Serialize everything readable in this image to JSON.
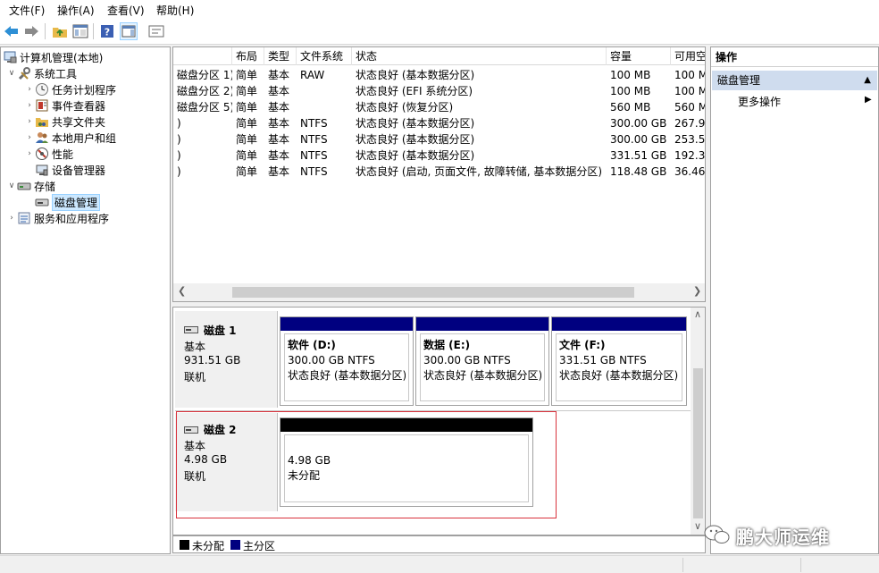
{
  "menu": [
    "文件(F)",
    "操作(A)",
    "查看(V)",
    "帮助(H)"
  ],
  "tree": {
    "root": "计算机管理(本地)",
    "system_tools": "系统工具",
    "task_scheduler": "任务计划程序",
    "event_viewer": "事件查看器",
    "shared_folders": "共享文件夹",
    "local_users": "本地用户和组",
    "performance": "性能",
    "device_manager": "设备管理器",
    "storage": "存储",
    "disk_management": "磁盘管理",
    "services_apps": "服务和应用程序"
  },
  "volume_list": {
    "columns": [
      "",
      "布局",
      "类型",
      "文件系统",
      "状态",
      "容量",
      "可用空"
    ],
    "rows": [
      [
        "磁盘分区 1)",
        "简单",
        "基本",
        "RAW",
        "状态良好 (基本数据分区)",
        "100 MB",
        "100 M"
      ],
      [
        "磁盘分区 2)",
        "简单",
        "基本",
        "",
        "状态良好 (EFI 系统分区)",
        "100 MB",
        "100 M"
      ],
      [
        "磁盘分区 5)",
        "简单",
        "基本",
        "",
        "状态良好 (恢复分区)",
        "560 MB",
        "560 M"
      ],
      [
        ")",
        "简单",
        "基本",
        "NTFS",
        "状态良好 (基本数据分区)",
        "300.00 GB",
        "267.9"
      ],
      [
        ")",
        "简单",
        "基本",
        "NTFS",
        "状态良好 (基本数据分区)",
        "300.00 GB",
        "253.5"
      ],
      [
        ")",
        "简单",
        "基本",
        "NTFS",
        "状态良好 (基本数据分区)",
        "331.51 GB",
        "192.3"
      ],
      [
        ")",
        "简单",
        "基本",
        "NTFS",
        "状态良好 (启动, 页面文件, 故障转储, 基本数据分区)",
        "118.48 GB",
        "36.46"
      ]
    ]
  },
  "disks": {
    "disk1": {
      "name": "磁盘 1",
      "type": "基本",
      "size": "931.51 GB",
      "status": "联机",
      "partitions": [
        {
          "label": "软件 (D:)",
          "size": "300.00 GB NTFS",
          "status": "状态良好 (基本数据分区)"
        },
        {
          "label": "数据 (E:)",
          "size": "300.00 GB NTFS",
          "status": "状态良好 (基本数据分区)"
        },
        {
          "label": "文件 (F:)",
          "size": "331.51 GB NTFS",
          "status": "状态良好 (基本数据分区)"
        }
      ]
    },
    "disk2": {
      "name": "磁盘 2",
      "type": "基本",
      "size": "4.98 GB",
      "status": "联机",
      "partitions": [
        {
          "size": "4.98 GB",
          "status": "未分配"
        }
      ]
    }
  },
  "legend": {
    "unallocated": "未分配",
    "primary": "主分区",
    "unallocated_color": "#000000",
    "primary_color": "#000080"
  },
  "actions": {
    "title": "操作",
    "section": "磁盘管理",
    "more": "更多操作"
  },
  "watermark": "鹏大师运维",
  "colors": {
    "selection": "#cce8ff",
    "highlight_box": "#d9323c",
    "action_section": "#cfdcee"
  }
}
